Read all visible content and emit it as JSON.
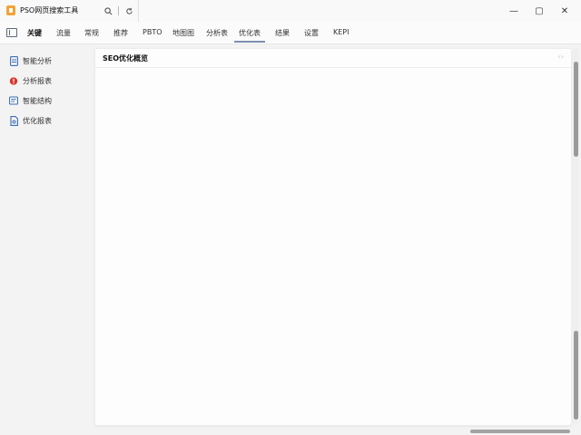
{
  "window": {
    "title": "PSO网页搜索工具",
    "search_icon": "search-icon",
    "refresh_icon": "refresh-icon",
    "controls": {
      "minimize": "—",
      "maximize": "▢",
      "close": "✕"
    }
  },
  "tabs": [
    {
      "label": "关键"
    },
    {
      "label": "流量"
    },
    {
      "label": "常规"
    },
    {
      "label": "推荐"
    },
    {
      "label": "PBTO"
    },
    {
      "label": "地图图"
    },
    {
      "label": "分析表"
    },
    {
      "label": "优化表"
    },
    {
      "label": "结果"
    },
    {
      "label": "设置"
    },
    {
      "label": "KEPI"
    }
  ],
  "active_tab_index": 7,
  "sidebar": {
    "items": [
      {
        "label": "智能分析",
        "icon": "document-icon",
        "color": "#3a6fb5"
      },
      {
        "label": "分析报表",
        "icon": "alert-icon",
        "color": "#d9362b"
      },
      {
        "label": "智能结构",
        "icon": "chart-icon",
        "color": "#3a6fb5"
      },
      {
        "label": "优化报表",
        "icon": "file-icon",
        "color": "#3a6fb5"
      }
    ]
  },
  "panel": {
    "title": "SEO优化概览",
    "close_label": "‹›"
  },
  "colors": {
    "accent": "#7a8fb0",
    "app_icon": "#f2a33a",
    "background": "#f3f3f3"
  }
}
